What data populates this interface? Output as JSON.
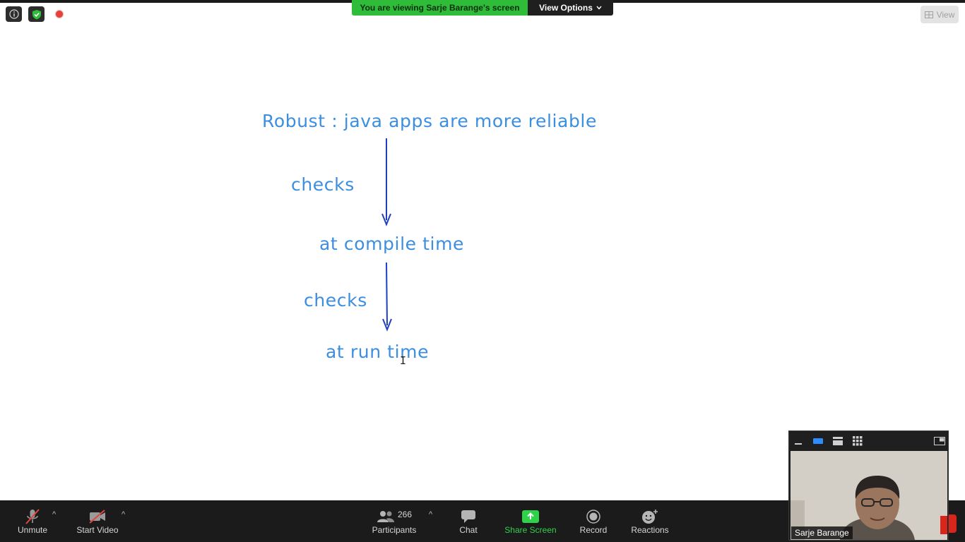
{
  "top": {
    "info_icon": "info-icon",
    "security_icon": "shield-check-icon",
    "recording_indicator": "record-dot-icon",
    "banner_text": "You are viewing Sarje Barange's screen",
    "view_options_label": "View Options",
    "view_button_label": "View"
  },
  "shared_screen": {
    "title": "Robust : java apps are more reliable",
    "label_checks_1": "checks",
    "label_compile": "at compile time",
    "label_checks_2": "checks",
    "label_run": "at run time",
    "text_color": "#3b8ee0",
    "arrow_color": "#1f3fbf"
  },
  "toolbar": {
    "unmute_label": "Unmute",
    "start_video_label": "Start Video",
    "participants_label": "Participants",
    "participants_count": "266",
    "chat_label": "Chat",
    "share_label": "Share Screen",
    "record_label": "Record",
    "reactions_label": "Reactions",
    "share_color": "#2fd34a"
  },
  "video_panel": {
    "participant_name": "Sarje Barange",
    "controls": [
      "minimize-icon",
      "speaker-view-icon",
      "strip-view-icon",
      "gallery-icon",
      "exit-fullscreen-icon"
    ]
  }
}
